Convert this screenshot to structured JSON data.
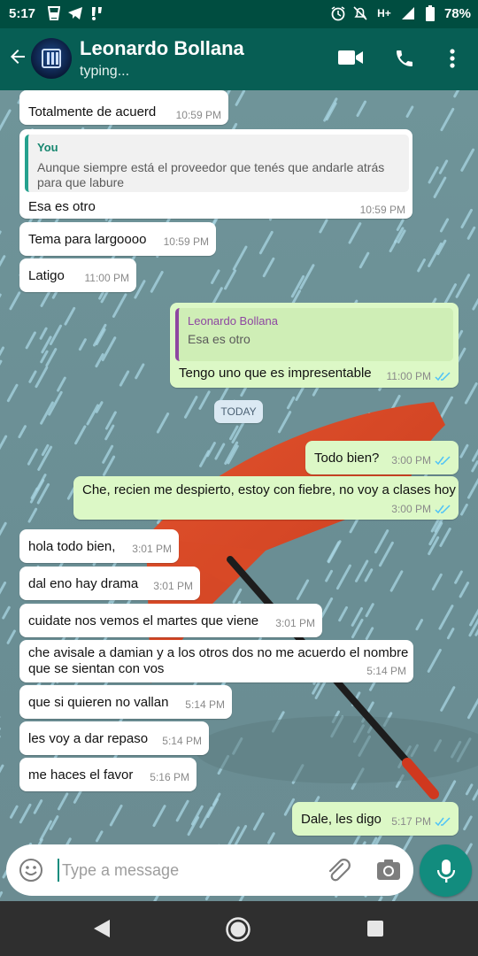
{
  "status_bar": {
    "time": "5:17",
    "network": "H+",
    "battery": "78%"
  },
  "header": {
    "contact_name": "Leonardo Bollana",
    "status": "typing...",
    "icons": [
      "back-arrow-icon",
      "video-call-icon",
      "phone-call-icon",
      "more-vert-icon"
    ]
  },
  "day_separator": "TODAY",
  "messages": [
    {
      "dir": "in",
      "text": "Totalmente de acuerd",
      "time": "10:59 PM"
    },
    {
      "dir": "in",
      "quote": {
        "author": "You",
        "text": "Aunque siempre está el proveedor que tenés que andarle atrás para que labure"
      },
      "text": "Esa es otro",
      "time": "10:59 PM"
    },
    {
      "dir": "in",
      "text": "Tema para largoooo",
      "time": "10:59 PM"
    },
    {
      "dir": "in",
      "text": "Latigo",
      "time": "11:00 PM"
    },
    {
      "dir": "out",
      "quote": {
        "author": "Leonardo Bollana",
        "text": "Esa es otro"
      },
      "text": "Tengo uno que es impresentable",
      "time": "11:00 PM",
      "read": true
    },
    {
      "dir": "out",
      "text": "Todo bien?",
      "time": "3:00 PM",
      "read": true
    },
    {
      "dir": "out",
      "text": "Che, recien me despierto, estoy con fiebre, no voy a clases hoy",
      "time": "3:00 PM",
      "read": true
    },
    {
      "dir": "in",
      "text": "hola todo bien,",
      "time": "3:01 PM"
    },
    {
      "dir": "in",
      "text": "dal eno hay drama",
      "time": "3:01 PM"
    },
    {
      "dir": "in",
      "text": "cuidate nos vemos el martes que viene",
      "time": "3:01 PM"
    },
    {
      "dir": "in",
      "text": "che avisale a damian y a los otros dos no me acuerdo el nombre que se sientan con vos",
      "time": "5:14 PM"
    },
    {
      "dir": "in",
      "text": "que si quieren no vallan",
      "time": "5:14 PM"
    },
    {
      "dir": "in",
      "text": "les voy a dar repaso",
      "time": "5:14 PM"
    },
    {
      "dir": "in",
      "text": "me haces el favor",
      "time": "5:16 PM"
    },
    {
      "dir": "out",
      "text": "Dale, les digo",
      "time": "5:17 PM",
      "read": true
    }
  ],
  "composer": {
    "placeholder": "Type a message",
    "value": ""
  },
  "colors": {
    "header": "#075e54",
    "status_bar": "#004d40",
    "outgoing_bubble": "#dcf8c6",
    "incoming_bubble": "#ffffff",
    "accent": "#128c7e",
    "read_ticks": "#4fc3f7"
  }
}
